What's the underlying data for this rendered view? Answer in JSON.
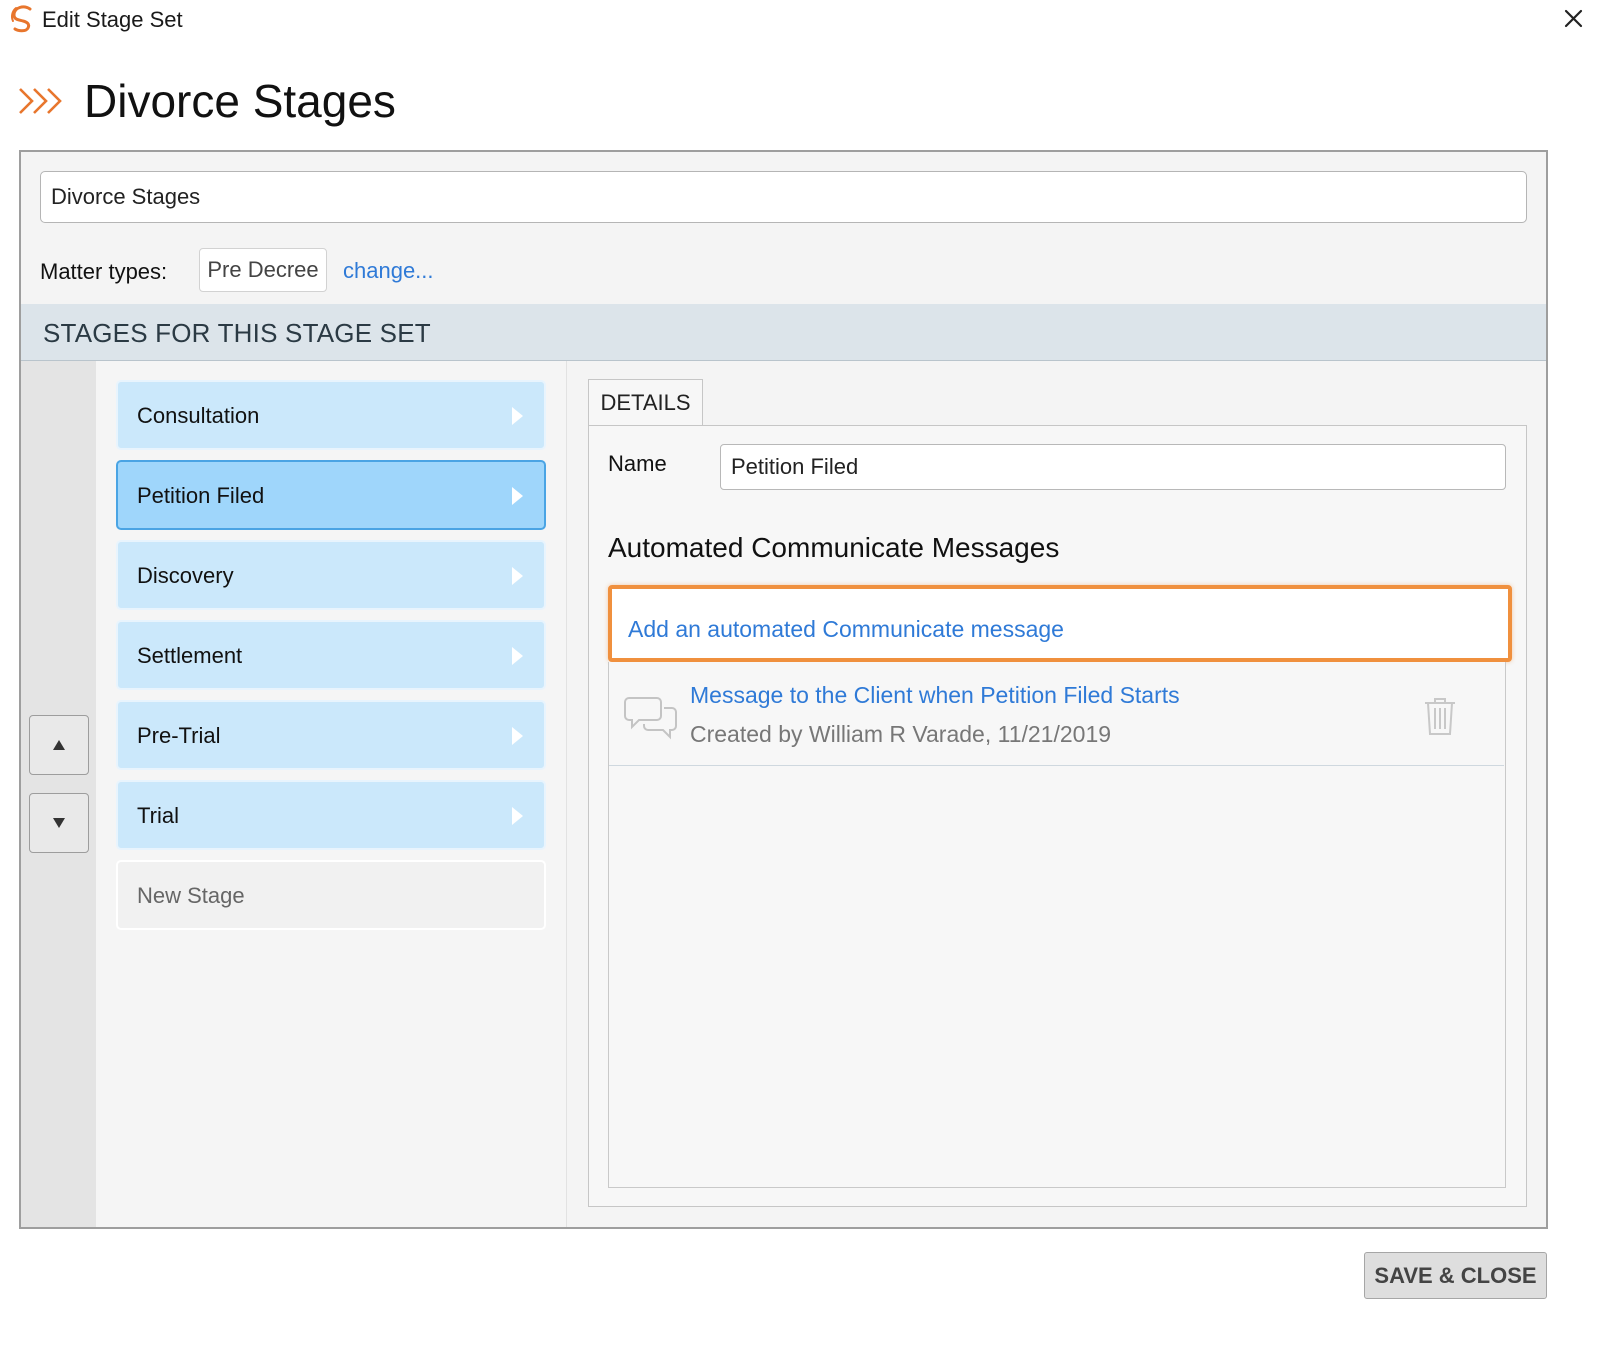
{
  "window": {
    "title": "Edit Stage Set",
    "logo_icon": "smokeball-logo-icon",
    "close_icon": "close-icon"
  },
  "header": {
    "icon": "stages-chevrons-icon",
    "title": "Divorce Stages"
  },
  "form": {
    "stage_set_name": "Divorce Stages",
    "matter_types_label": "Matter types:",
    "matter_type_value": "Pre Decree",
    "change_link": "change..."
  },
  "stages_section": {
    "heading": "STAGES FOR THIS STAGE SET",
    "move_up_icon": "up-triangle-icon",
    "move_down_icon": "down-triangle-icon",
    "items": [
      {
        "label": "Consultation",
        "selected": false
      },
      {
        "label": "Petition Filed",
        "selected": true
      },
      {
        "label": "Discovery",
        "selected": false
      },
      {
        "label": "Settlement",
        "selected": false
      },
      {
        "label": "Pre-Trial",
        "selected": false
      },
      {
        "label": "Trial",
        "selected": false
      }
    ],
    "new_stage_placeholder": "New Stage"
  },
  "details": {
    "tab_label": "DETAILS",
    "name_label": "Name",
    "name_value": "Petition Filed",
    "automated_heading": "Automated Communicate Messages",
    "add_message_link": "Add an automated Communicate message",
    "messages": [
      {
        "title": "Message to the Client when Petition Filed Starts",
        "meta": "Created by William R Varade, 11/21/2019",
        "icon": "chat-bubbles-icon",
        "delete_icon": "trash-icon"
      }
    ]
  },
  "footer": {
    "save_close_label": "SAVE & CLOSE"
  },
  "colors": {
    "accent_orange": "#f0903e",
    "link_blue": "#2f7ad7",
    "stage_bg": "#cbe8fb",
    "stage_selected_bg": "#9fd6fb",
    "stage_selected_border": "#4aa4e4",
    "section_band": "#dce4ea"
  }
}
